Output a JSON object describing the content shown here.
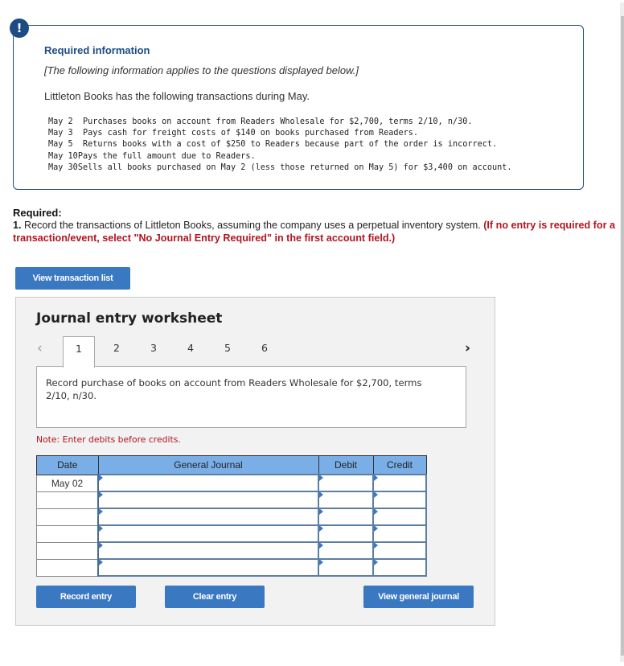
{
  "info": {
    "badge_icon": "!",
    "title": "Required information",
    "subtitle": "[The following information applies to the questions displayed below.]",
    "intro": "Littleton Books has the following transactions during May.",
    "transactions": [
      {
        "date": "May 2 ",
        "text": "Purchases books on account from Readers Wholesale for $2,700, terms 2/10, n/30."
      },
      {
        "date": "May 3 ",
        "text": "Pays cash for freight costs of $140 on books purchased from Readers."
      },
      {
        "date": "May 5 ",
        "text": "Returns books with a cost of $250 to Readers because part of the order is incorrect."
      },
      {
        "date": "May 10",
        "text": "Pays the full amount due to Readers."
      },
      {
        "date": "May 30",
        "text": "Sells all books purchased on May 2 (less those returned on May 5) for $3,400 on account."
      }
    ]
  },
  "required": {
    "label": "Required:",
    "number": "1.",
    "text": " Record the transactions of Littleton Books, assuming the company uses a perpetual inventory system. ",
    "note": "(If no entry is required for a transaction/event, select \"No Journal Entry Required\" in the first account field.)"
  },
  "buttons": {
    "view_transaction_list": "View transaction list",
    "record_entry": "Record entry",
    "clear_entry": "Clear entry",
    "view_general_journal": "View general journal"
  },
  "worksheet": {
    "title": "Journal entry worksheet",
    "prev_icon": "‹",
    "next_icon": "›",
    "tabs": [
      "1",
      "2",
      "3",
      "4",
      "5",
      "6"
    ],
    "active_tab": "1",
    "description": "Record purchase of books on account from Readers Wholesale for $2,700, terms 2/10, n/30.",
    "note": "Note: Enter debits before credits.",
    "table": {
      "headers": {
        "date": "Date",
        "journal": "General Journal",
        "debit": "Debit",
        "credit": "Credit"
      },
      "rows": [
        {
          "date": "May 02",
          "account": "",
          "debit": "",
          "credit": ""
        },
        {
          "date": "",
          "account": "",
          "debit": "",
          "credit": ""
        },
        {
          "date": "",
          "account": "",
          "debit": "",
          "credit": ""
        },
        {
          "date": "",
          "account": "",
          "debit": "",
          "credit": ""
        },
        {
          "date": "",
          "account": "",
          "debit": "",
          "credit": ""
        },
        {
          "date": "",
          "account": "",
          "debit": "",
          "credit": ""
        }
      ]
    }
  },
  "colors": {
    "brand_navy": "#1d4c85",
    "button_blue": "#3b78c2",
    "header_blue": "#7aaee6",
    "alert_red": "#b3141f"
  }
}
